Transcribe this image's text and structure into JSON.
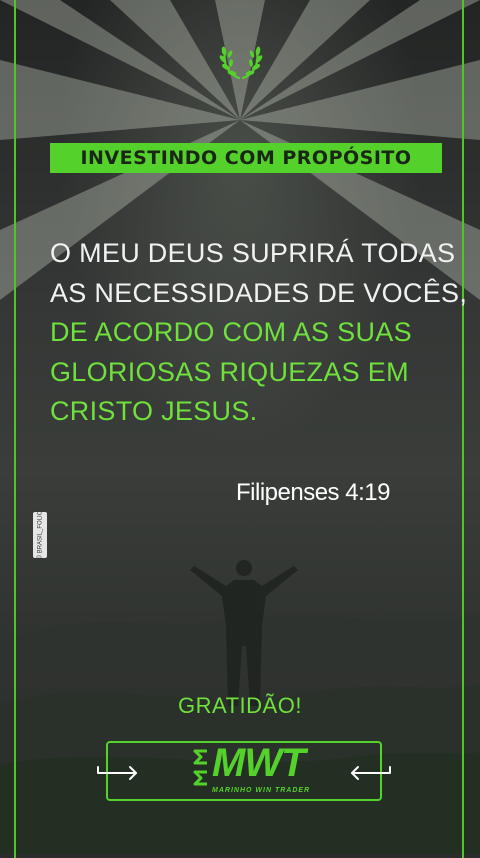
{
  "banner": {
    "text": "INVESTINDO COM PROPÓSITO"
  },
  "quote": {
    "lines": [
      "O MEU DEUS SUPRIRÁ TODAS",
      "AS NECESSIDADES DE VOCÊS,",
      "DE ACORDO COM AS SUAS",
      "GLORIOSAS RIQUEZAS EM",
      "CRISTO JESUS."
    ],
    "white_color": "#f1f1f1",
    "highlight_color": "#6fe03c"
  },
  "reference": "Filipenses 4:19",
  "photo_credit": "© BRASIL_FOLIO",
  "gratitude": "GRATIDÃO!",
  "logo": {
    "mark": "MW",
    "name": "MWT",
    "subtitle": "MARINHO WIN TRADER"
  },
  "colors": {
    "accent": "#55d12b",
    "frame": "#4fc52a"
  },
  "icons": [
    "laurel-icon",
    "arrow-right-icon",
    "arrow-left-icon"
  ]
}
